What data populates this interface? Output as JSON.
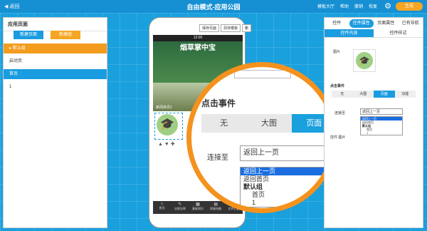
{
  "topbar": {
    "back": "返回",
    "title": "自由模式-应用公园",
    "tools": [
      "模板大厅",
      "帮助",
      "撤销",
      "恢复"
    ],
    "generate": "生成"
  },
  "left": {
    "heading": "应用页面",
    "new_page": "新建页面",
    "new_group": "新建组",
    "items": [
      {
        "label": "默认组"
      },
      {
        "label": "启动页"
      },
      {
        "label": "首页"
      },
      {
        "label": "1"
      }
    ]
  },
  "phone": {
    "tools": [
      "保存页面",
      "另存模板",
      "删"
    ],
    "time": "12:00",
    "banner_title": "烟草掌中宝",
    "caption": "新闻资讯1",
    "nav": [
      "首页",
      "法规法律",
      "基础知识",
      "职级技能",
      "文件汇编"
    ]
  },
  "magnifier": {
    "event_title": "点击事件",
    "segments": [
      "无",
      "大图",
      "页面"
    ],
    "active_segment": "页面",
    "link_label": "连接至",
    "selected": "返回上一页",
    "options": [
      "返回上一页",
      "返回首页",
      "默认组",
      "首页",
      "1"
    ]
  },
  "right": {
    "tabs": [
      "控件",
      "控件属性",
      "页面属性",
      "已有导航"
    ],
    "active_tab": "控件属性",
    "subtabs": [
      "控件内容",
      "控件样式"
    ],
    "pic_label": "图片",
    "event_title": "点击事件",
    "segments": [
      "无",
      "大图",
      "页面",
      "功能"
    ],
    "link_label": "连接至",
    "selected": "返回上一页",
    "options": [
      "返回上一页",
      "返回首页",
      "默认组",
      "首页",
      "1"
    ],
    "control_label": "控件",
    "picture_label": "图片"
  }
}
